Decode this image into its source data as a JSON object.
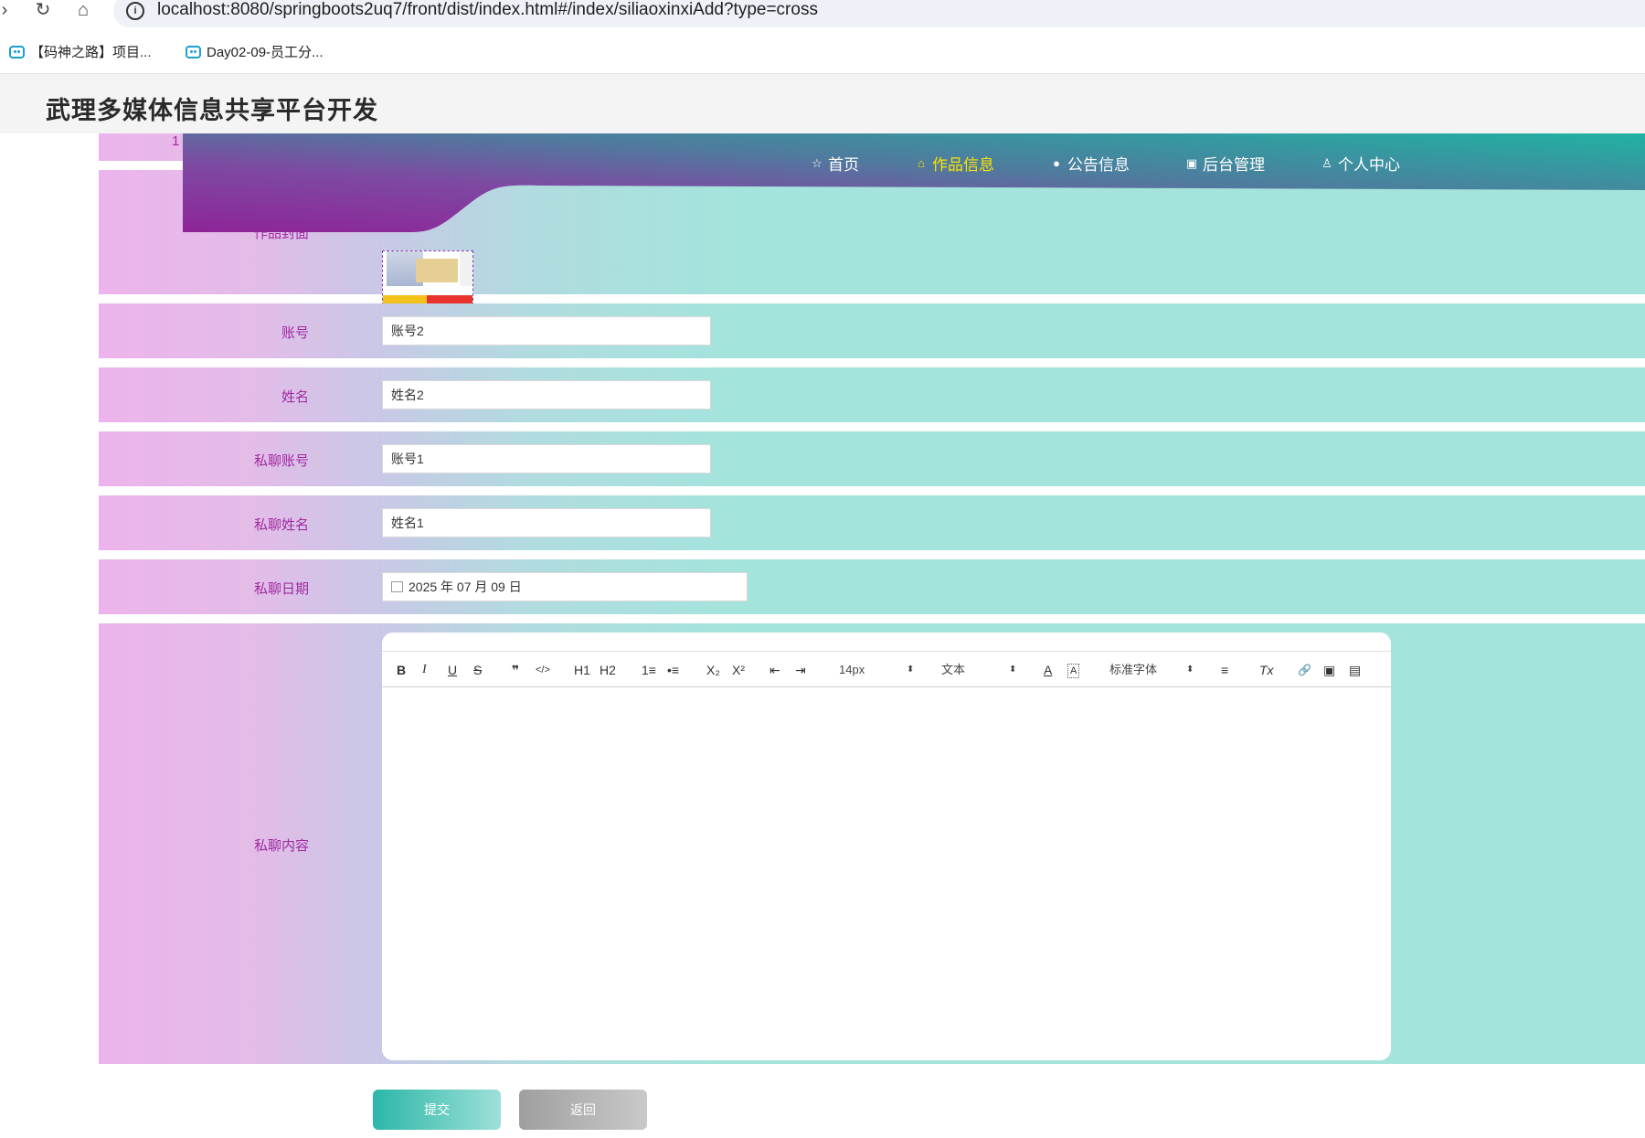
{
  "browser": {
    "url": "localhost:8080/springboots2uq7/front/dist/index.html#/index/siliaoxinxiAdd?type=cross",
    "bookmarks": [
      {
        "label": "【码神之路】项目..."
      },
      {
        "label": "Day02-09-员工分..."
      }
    ]
  },
  "site": {
    "title": "武理多媒体信息共享平台开发"
  },
  "nav": {
    "items": [
      {
        "label": "首页",
        "icon": "star-icon"
      },
      {
        "label": "作品信息",
        "icon": "bag-icon",
        "active": true
      },
      {
        "label": "公告信息",
        "icon": "info-circle-icon"
      },
      {
        "label": "后台管理",
        "icon": "gift-icon"
      },
      {
        "label": "个人中心",
        "icon": "user-icon"
      }
    ]
  },
  "form": {
    "cover_label": "作品封面",
    "account": {
      "label": "账号",
      "value": "账号2"
    },
    "name": {
      "label": "姓名",
      "value": "姓名2"
    },
    "chat_account": {
      "label": "私聊账号",
      "value": "账号1"
    },
    "chat_name": {
      "label": "私聊姓名",
      "value": "姓名1"
    },
    "chat_date": {
      "label": "私聊日期",
      "value": "2025 年 07 月 09 日"
    },
    "chat_content": {
      "label": "私聊内容"
    }
  },
  "editor": {
    "toolbar": {
      "bold": "B",
      "italic": "I",
      "underline": "U",
      "strike": "S",
      "quote": "❞",
      "code": "</>",
      "h1": "H1",
      "h2": "H2",
      "ordered_list": "1≡",
      "bullet_list": "•≡",
      "subscript": "X₂",
      "superscript": "X²",
      "outdent": "⇤",
      "indent": "⇥",
      "size": "14px",
      "header": "文本",
      "font": "标准字体",
      "color": "A",
      "background": "A",
      "align": "≡",
      "clean": "Tx",
      "link": "🔗",
      "image": "▣",
      "video": "▤"
    }
  },
  "buttons": {
    "submit": "提交",
    "back": "返回"
  },
  "colors": {
    "nav_gradient_start": "#8e2497",
    "nav_gradient_end": "#20b2a2",
    "row_pink": "#ecb4ec",
    "row_teal": "#a5e3dd",
    "label_color": "#a02aa0",
    "active_nav": "#ffe200"
  }
}
